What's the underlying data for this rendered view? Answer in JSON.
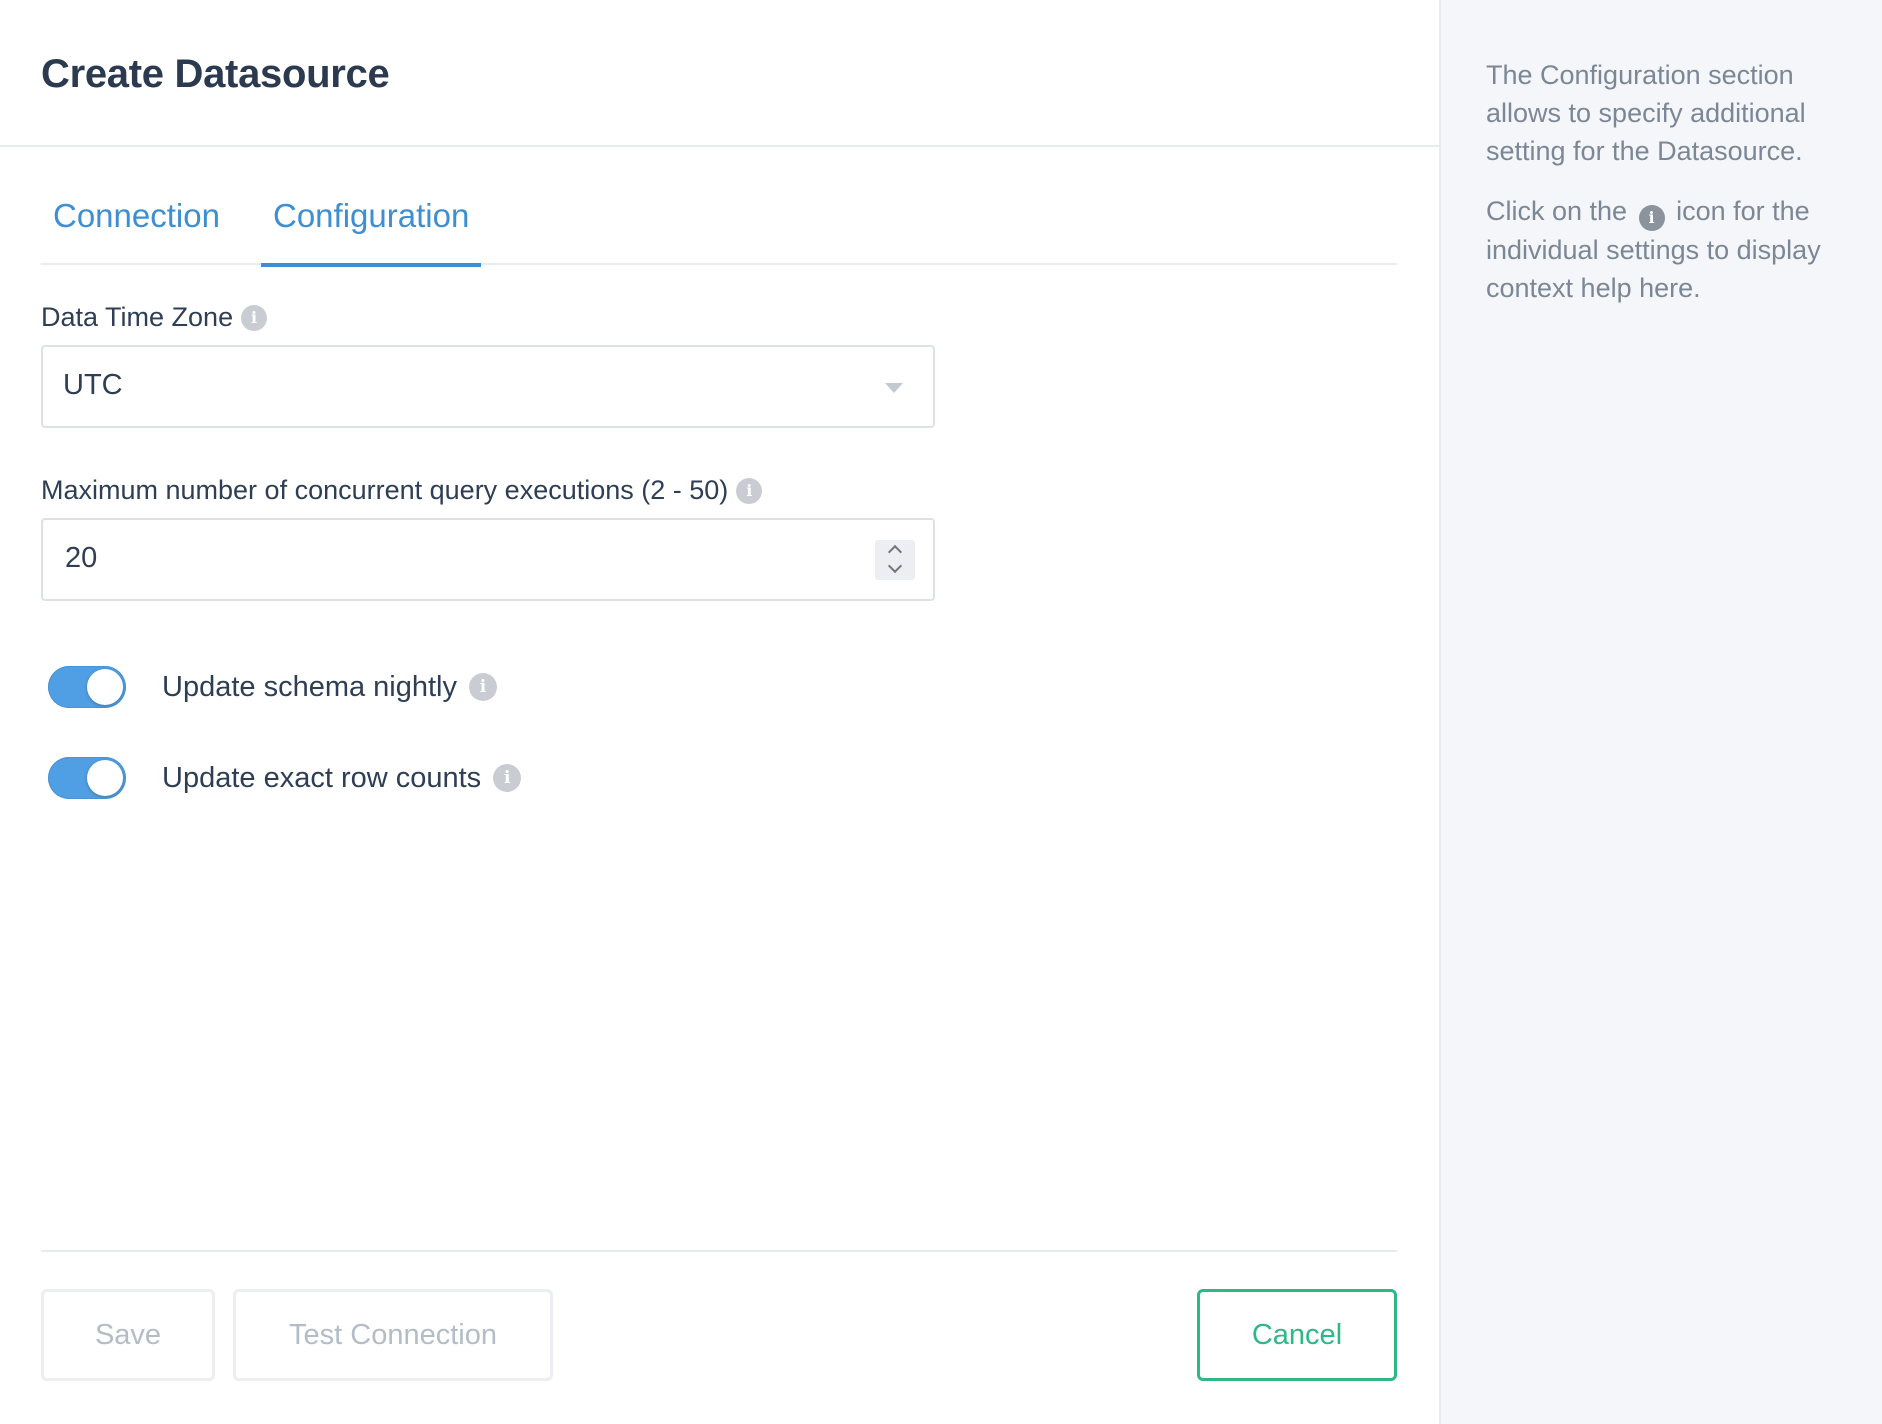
{
  "header": {
    "title": "Create Datasource"
  },
  "tabs": [
    {
      "label": "Connection",
      "active": false
    },
    {
      "label": "Configuration",
      "active": true
    }
  ],
  "fields": {
    "timezone": {
      "label": "Data Time Zone",
      "value": "UTC"
    },
    "concurrency": {
      "label": "Maximum number of concurrent query executions (2 - 50)",
      "value": "20"
    }
  },
  "toggles": [
    {
      "label": "Update schema nightly",
      "enabled": true
    },
    {
      "label": "Update exact row counts",
      "enabled": true
    }
  ],
  "buttons": {
    "save": "Save",
    "test": "Test Connection",
    "cancel": "Cancel"
  },
  "help": {
    "paragraph1": "The Configuration section allows to specify additional setting for the Datasource.",
    "paragraph2_before": "Click on the",
    "paragraph2_after": "icon for the individual settings to display context help here."
  },
  "icons": {
    "info": "info-icon",
    "dropdown": "chevron-down-icon"
  },
  "colors": {
    "accent_blue": "#509ee3",
    "tab_blue": "#3d8fd1",
    "cancel_green": "#2eb787",
    "help_bg": "#f4f6f9"
  }
}
